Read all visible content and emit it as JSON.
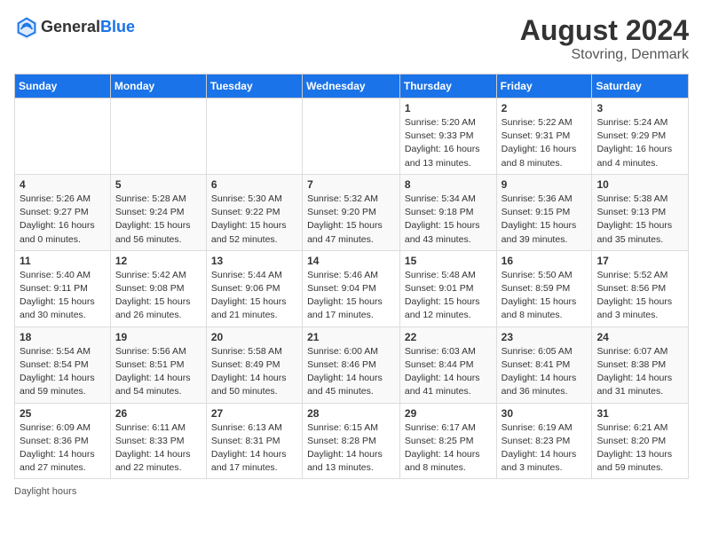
{
  "header": {
    "logo_general": "General",
    "logo_blue": "Blue",
    "month_year": "August 2024",
    "location": "Stovring, Denmark"
  },
  "footer": {
    "label": "Daylight hours"
  },
  "days_of_week": [
    "Sunday",
    "Monday",
    "Tuesday",
    "Wednesday",
    "Thursday",
    "Friday",
    "Saturday"
  ],
  "weeks": [
    [
      {
        "day": "",
        "sunrise": "",
        "sunset": "",
        "daylight": ""
      },
      {
        "day": "",
        "sunrise": "",
        "sunset": "",
        "daylight": ""
      },
      {
        "day": "",
        "sunrise": "",
        "sunset": "",
        "daylight": ""
      },
      {
        "day": "",
        "sunrise": "",
        "sunset": "",
        "daylight": ""
      },
      {
        "day": "1",
        "sunrise": "Sunrise: 5:20 AM",
        "sunset": "Sunset: 9:33 PM",
        "daylight": "Daylight: 16 hours and 13 minutes."
      },
      {
        "day": "2",
        "sunrise": "Sunrise: 5:22 AM",
        "sunset": "Sunset: 9:31 PM",
        "daylight": "Daylight: 16 hours and 8 minutes."
      },
      {
        "day": "3",
        "sunrise": "Sunrise: 5:24 AM",
        "sunset": "Sunset: 9:29 PM",
        "daylight": "Daylight: 16 hours and 4 minutes."
      }
    ],
    [
      {
        "day": "4",
        "sunrise": "Sunrise: 5:26 AM",
        "sunset": "Sunset: 9:27 PM",
        "daylight": "Daylight: 16 hours and 0 minutes."
      },
      {
        "day": "5",
        "sunrise": "Sunrise: 5:28 AM",
        "sunset": "Sunset: 9:24 PM",
        "daylight": "Daylight: 15 hours and 56 minutes."
      },
      {
        "day": "6",
        "sunrise": "Sunrise: 5:30 AM",
        "sunset": "Sunset: 9:22 PM",
        "daylight": "Daylight: 15 hours and 52 minutes."
      },
      {
        "day": "7",
        "sunrise": "Sunrise: 5:32 AM",
        "sunset": "Sunset: 9:20 PM",
        "daylight": "Daylight: 15 hours and 47 minutes."
      },
      {
        "day": "8",
        "sunrise": "Sunrise: 5:34 AM",
        "sunset": "Sunset: 9:18 PM",
        "daylight": "Daylight: 15 hours and 43 minutes."
      },
      {
        "day": "9",
        "sunrise": "Sunrise: 5:36 AM",
        "sunset": "Sunset: 9:15 PM",
        "daylight": "Daylight: 15 hours and 39 minutes."
      },
      {
        "day": "10",
        "sunrise": "Sunrise: 5:38 AM",
        "sunset": "Sunset: 9:13 PM",
        "daylight": "Daylight: 15 hours and 35 minutes."
      }
    ],
    [
      {
        "day": "11",
        "sunrise": "Sunrise: 5:40 AM",
        "sunset": "Sunset: 9:11 PM",
        "daylight": "Daylight: 15 hours and 30 minutes."
      },
      {
        "day": "12",
        "sunrise": "Sunrise: 5:42 AM",
        "sunset": "Sunset: 9:08 PM",
        "daylight": "Daylight: 15 hours and 26 minutes."
      },
      {
        "day": "13",
        "sunrise": "Sunrise: 5:44 AM",
        "sunset": "Sunset: 9:06 PM",
        "daylight": "Daylight: 15 hours and 21 minutes."
      },
      {
        "day": "14",
        "sunrise": "Sunrise: 5:46 AM",
        "sunset": "Sunset: 9:04 PM",
        "daylight": "Daylight: 15 hours and 17 minutes."
      },
      {
        "day": "15",
        "sunrise": "Sunrise: 5:48 AM",
        "sunset": "Sunset: 9:01 PM",
        "daylight": "Daylight: 15 hours and 12 minutes."
      },
      {
        "day": "16",
        "sunrise": "Sunrise: 5:50 AM",
        "sunset": "Sunset: 8:59 PM",
        "daylight": "Daylight: 15 hours and 8 minutes."
      },
      {
        "day": "17",
        "sunrise": "Sunrise: 5:52 AM",
        "sunset": "Sunset: 8:56 PM",
        "daylight": "Daylight: 15 hours and 3 minutes."
      }
    ],
    [
      {
        "day": "18",
        "sunrise": "Sunrise: 5:54 AM",
        "sunset": "Sunset: 8:54 PM",
        "daylight": "Daylight: 14 hours and 59 minutes."
      },
      {
        "day": "19",
        "sunrise": "Sunrise: 5:56 AM",
        "sunset": "Sunset: 8:51 PM",
        "daylight": "Daylight: 14 hours and 54 minutes."
      },
      {
        "day": "20",
        "sunrise": "Sunrise: 5:58 AM",
        "sunset": "Sunset: 8:49 PM",
        "daylight": "Daylight: 14 hours and 50 minutes."
      },
      {
        "day": "21",
        "sunrise": "Sunrise: 6:00 AM",
        "sunset": "Sunset: 8:46 PM",
        "daylight": "Daylight: 14 hours and 45 minutes."
      },
      {
        "day": "22",
        "sunrise": "Sunrise: 6:03 AM",
        "sunset": "Sunset: 8:44 PM",
        "daylight": "Daylight: 14 hours and 41 minutes."
      },
      {
        "day": "23",
        "sunrise": "Sunrise: 6:05 AM",
        "sunset": "Sunset: 8:41 PM",
        "daylight": "Daylight: 14 hours and 36 minutes."
      },
      {
        "day": "24",
        "sunrise": "Sunrise: 6:07 AM",
        "sunset": "Sunset: 8:38 PM",
        "daylight": "Daylight: 14 hours and 31 minutes."
      }
    ],
    [
      {
        "day": "25",
        "sunrise": "Sunrise: 6:09 AM",
        "sunset": "Sunset: 8:36 PM",
        "daylight": "Daylight: 14 hours and 27 minutes."
      },
      {
        "day": "26",
        "sunrise": "Sunrise: 6:11 AM",
        "sunset": "Sunset: 8:33 PM",
        "daylight": "Daylight: 14 hours and 22 minutes."
      },
      {
        "day": "27",
        "sunrise": "Sunrise: 6:13 AM",
        "sunset": "Sunset: 8:31 PM",
        "daylight": "Daylight: 14 hours and 17 minutes."
      },
      {
        "day": "28",
        "sunrise": "Sunrise: 6:15 AM",
        "sunset": "Sunset: 8:28 PM",
        "daylight": "Daylight: 14 hours and 13 minutes."
      },
      {
        "day": "29",
        "sunrise": "Sunrise: 6:17 AM",
        "sunset": "Sunset: 8:25 PM",
        "daylight": "Daylight: 14 hours and 8 minutes."
      },
      {
        "day": "30",
        "sunrise": "Sunrise: 6:19 AM",
        "sunset": "Sunset: 8:23 PM",
        "daylight": "Daylight: 14 hours and 3 minutes."
      },
      {
        "day": "31",
        "sunrise": "Sunrise: 6:21 AM",
        "sunset": "Sunset: 8:20 PM",
        "daylight": "Daylight: 13 hours and 59 minutes."
      }
    ]
  ]
}
